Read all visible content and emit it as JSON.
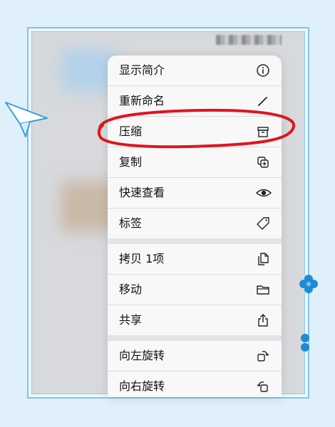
{
  "context_menu": {
    "groups": [
      [
        {
          "label": "显示简介",
          "icon": "info-icon"
        },
        {
          "label": "重新命名",
          "icon": "pencil-icon"
        },
        {
          "label": "压缩",
          "icon": "archive-box-icon"
        },
        {
          "label": "复制",
          "icon": "duplicate-icon"
        },
        {
          "label": "快速查看",
          "icon": "eye-icon"
        },
        {
          "label": "标签",
          "icon": "tag-icon"
        }
      ],
      [
        {
          "label": "拷贝 1项",
          "icon": "copy-doc-icon"
        },
        {
          "label": "移动",
          "icon": "folder-icon"
        },
        {
          "label": "共享",
          "icon": "share-icon"
        }
      ],
      [
        {
          "label": "向左旋转",
          "icon": "rotate-left-icon"
        },
        {
          "label": "向右旋转",
          "icon": "rotate-right-icon"
        }
      ]
    ]
  },
  "annotation": {
    "highlighted_item": "压缩",
    "color": "#e0151c"
  },
  "colors": {
    "frame_border": "#7ec4e6",
    "page_bg": "#dff0fb",
    "menu_bg": "#f8f8f9",
    "deco_blue": "#1e8bd6"
  }
}
